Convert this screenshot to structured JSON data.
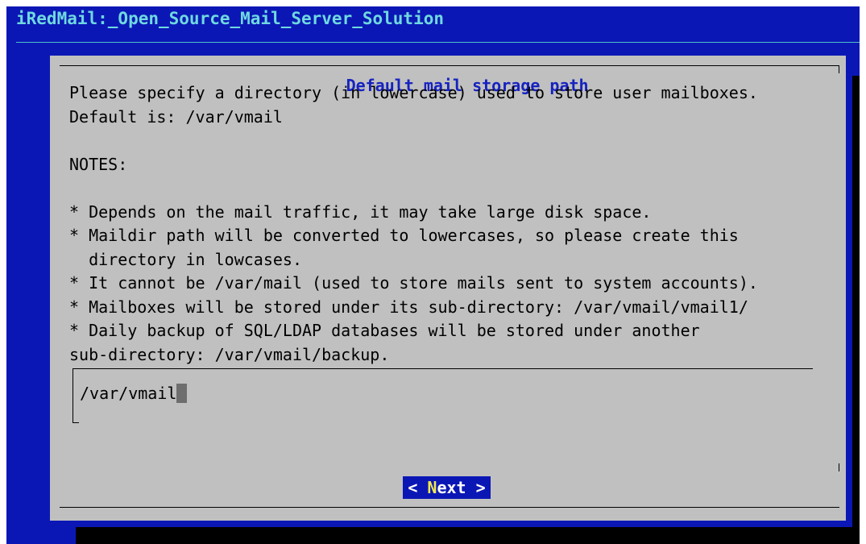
{
  "backtitle": "iRedMail:_Open_Source_Mail_Server_Solution",
  "dialog": {
    "title": "Default mail storage path",
    "body": "Please specify a directory (in lowercase) used to store user mailboxes.\nDefault is: /var/vmail\n\nNOTES:\n\n* Depends on the mail traffic, it may take large disk space.\n* Maildir path will be converted to lowercases, so please create this\n  directory in lowcases.\n* It cannot be /var/mail (used to store mails sent to system accounts).\n* Mailboxes will be stored under its sub-directory: /var/vmail/vmail1/\n* Daily backup of SQL/LDAP databases will be stored under another\nsub-directory: /var/vmail/backup."
  },
  "input": {
    "value": "/var/vmail"
  },
  "button": {
    "left_bracket": "<",
    "hotkey": "N",
    "label_rest": "ext",
    "right_bracket": ">"
  },
  "colors": {
    "screen_background": "#0b17b5",
    "dialog_background": "#c0c0c0",
    "backtitle_text": "#6fd9df",
    "title_text": "#1622c0",
    "button_background": "#0b17b5",
    "button_hotkey": "#f2e94e"
  }
}
